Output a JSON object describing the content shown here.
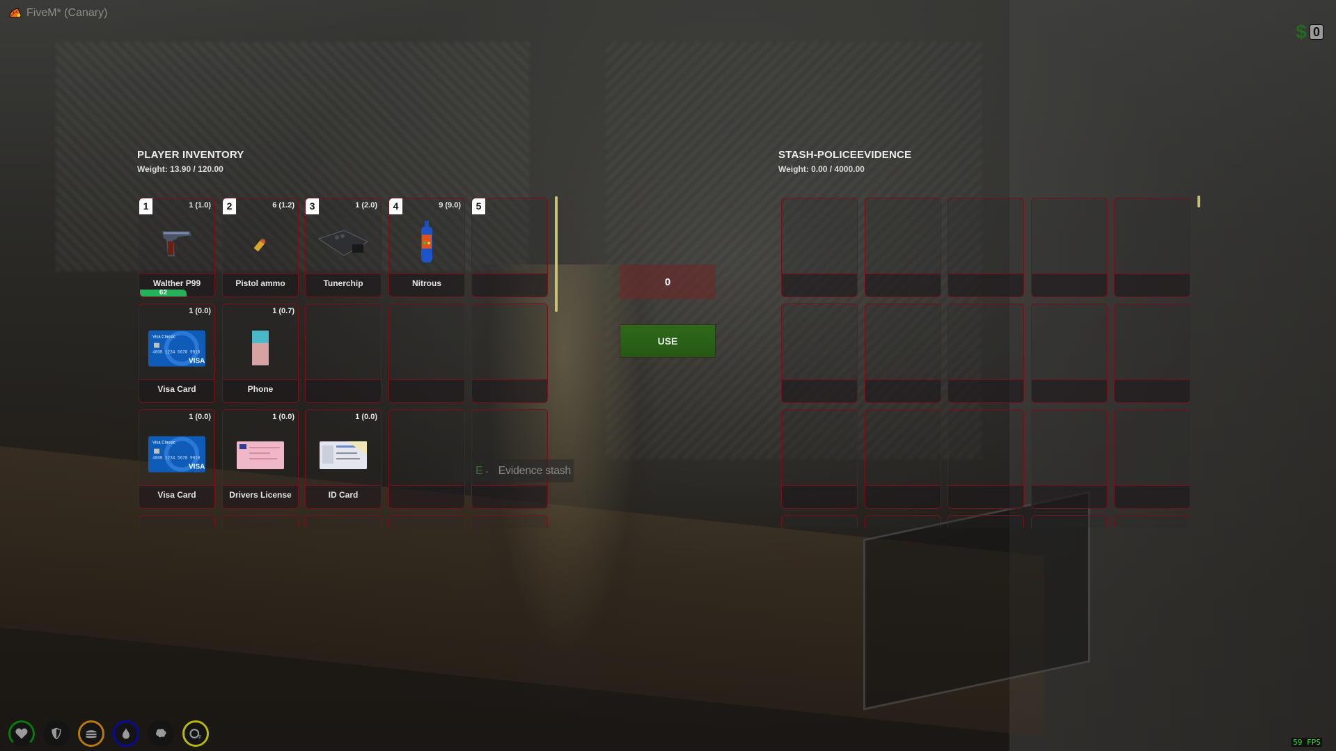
{
  "window": {
    "title": "FiveM* (Canary)",
    "logo_icon": "fivem-leaf-icon"
  },
  "hud": {
    "money_symbol": "$",
    "money_amount": "0",
    "fps": "59 FPS",
    "status_icons": [
      {
        "name": "health",
        "icon": "heart-icon",
        "ring_color": "#0a7a0a",
        "fill_fraction": 0.75
      },
      {
        "name": "armor",
        "icon": "shield-icon",
        "ring_color": "",
        "fill_fraction": 0
      },
      {
        "name": "hunger",
        "icon": "burger-icon",
        "ring_color": "#b87a0a",
        "fill_fraction": 1
      },
      {
        "name": "thirst",
        "icon": "water-drop-icon",
        "ring_color": "#0a0a9a",
        "fill_fraction": 1
      },
      {
        "name": "stress",
        "icon": "brain-icon",
        "ring_color": "",
        "fill_fraction": 0
      },
      {
        "name": "oxygen",
        "icon": "oxygen-icon",
        "ring_color": "#b8b80a",
        "fill_fraction": 1
      }
    ]
  },
  "player_inventory": {
    "title": "PLAYER INVENTORY",
    "weight": "Weight: 13.90 / 120.00",
    "slots": [
      {
        "hotkey": "1",
        "qty": "1 (1.0)",
        "label": "Walther P99",
        "icon": "pistol-icon",
        "durability": 62
      },
      {
        "hotkey": "2",
        "qty": "6 (1.2)",
        "label": "Pistol ammo",
        "icon": "bullet-icon"
      },
      {
        "hotkey": "3",
        "qty": "1 (2.0)",
        "label": "Tunerchip",
        "icon": "tunerchip-icon"
      },
      {
        "hotkey": "4",
        "qty": "9 (9.0)",
        "label": "Nitrous",
        "icon": "nitrous-bottle-icon"
      },
      {
        "hotkey": "5",
        "qty": "",
        "label": "",
        "icon": ""
      },
      {
        "hotkey": "",
        "qty": "1 (0.0)",
        "label": "Visa Card",
        "icon": "visa-card-icon"
      },
      {
        "hotkey": "",
        "qty": "1 (0.7)",
        "label": "Phone",
        "icon": "phone-icon"
      },
      {
        "hotkey": "",
        "qty": "",
        "label": "",
        "icon": ""
      },
      {
        "hotkey": "",
        "qty": "",
        "label": "",
        "icon": ""
      },
      {
        "hotkey": "",
        "qty": "",
        "label": "",
        "icon": ""
      },
      {
        "hotkey": "",
        "qty": "1 (0.0)",
        "label": "Visa Card",
        "icon": "visa-card-icon"
      },
      {
        "hotkey": "",
        "qty": "1 (0.0)",
        "label": "Drivers License",
        "icon": "drivers-license-icon"
      },
      {
        "hotkey": "",
        "qty": "1 (0.0)",
        "label": "ID Card",
        "icon": "id-card-icon"
      },
      {
        "hotkey": "",
        "qty": "",
        "label": "",
        "icon": ""
      },
      {
        "hotkey": "",
        "qty": "",
        "label": "",
        "icon": ""
      },
      {
        "hotkey": "",
        "qty": "",
        "label": "",
        "icon": ""
      },
      {
        "hotkey": "",
        "qty": "",
        "label": "",
        "icon": ""
      },
      {
        "hotkey": "",
        "qty": "",
        "label": "",
        "icon": ""
      },
      {
        "hotkey": "",
        "qty": "",
        "label": "",
        "icon": ""
      },
      {
        "hotkey": "",
        "qty": "",
        "label": "",
        "icon": ""
      }
    ]
  },
  "actions": {
    "amount_value": "0",
    "use_label": "USE"
  },
  "stash": {
    "title": "STASH-POLICEEVIDENCE",
    "weight": "Weight: 0.00 / 4000.00",
    "slot_count": 20
  },
  "prompt": {
    "key": "E",
    "separator": "-",
    "text": "Evidence stash"
  }
}
